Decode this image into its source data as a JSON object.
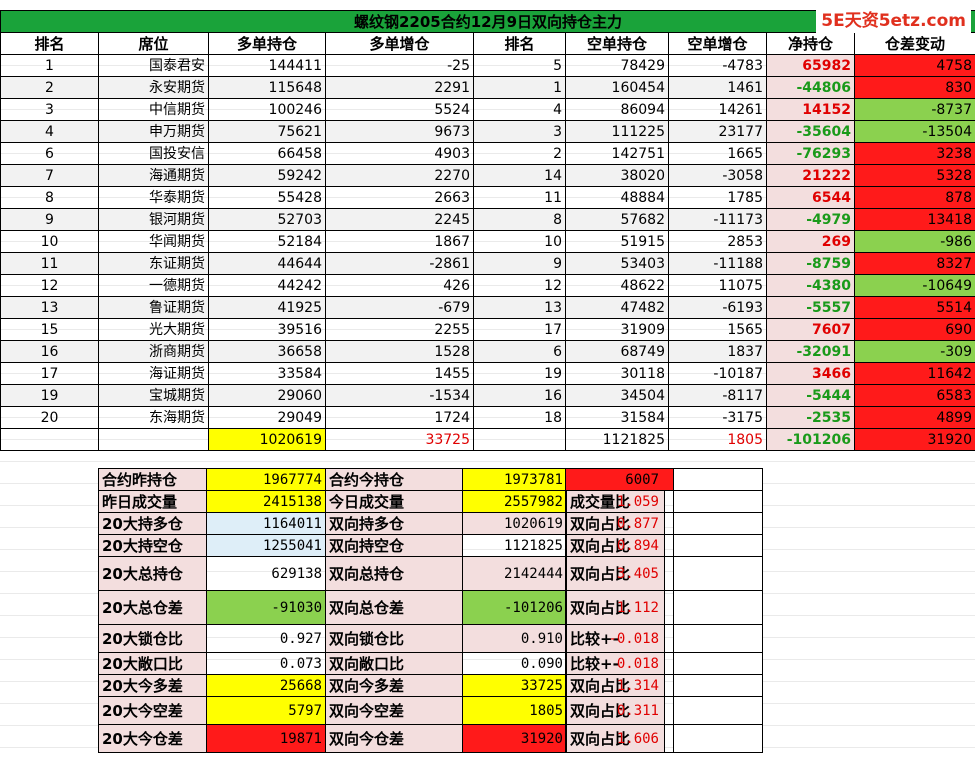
{
  "watermark": "5E天资5etz.com",
  "title": "螺纹钢2205合约12月9日双向持仓主力",
  "headers": [
    "排名",
    "席位",
    "多单持仓",
    "多单增仓",
    "排名",
    "空单持仓",
    "空单增仓",
    "净持仓",
    "仓差变动"
  ],
  "rows": [
    {
      "rank": "1",
      "firm": "国泰君安",
      "long": "144411",
      "long_chg": "-25",
      "srank": "5",
      "short": "78429",
      "short_chg": "-4783",
      "net": "65982",
      "diff": "4758"
    },
    {
      "rank": "2",
      "firm": "永安期货",
      "long": "115648",
      "long_chg": "2291",
      "srank": "1",
      "short": "160454",
      "short_chg": "1461",
      "net": "-44806",
      "diff": "830"
    },
    {
      "rank": "3",
      "firm": "中信期货",
      "long": "100246",
      "long_chg": "5524",
      "srank": "4",
      "short": "86094",
      "short_chg": "14261",
      "net": "14152",
      "diff": "-8737"
    },
    {
      "rank": "4",
      "firm": "申万期货",
      "long": "75621",
      "long_chg": "9673",
      "srank": "3",
      "short": "111225",
      "short_chg": "23177",
      "net": "-35604",
      "diff": "-13504"
    },
    {
      "rank": "6",
      "firm": "国投安信",
      "long": "66458",
      "long_chg": "4903",
      "srank": "2",
      "short": "142751",
      "short_chg": "1665",
      "net": "-76293",
      "diff": "3238"
    },
    {
      "rank": "7",
      "firm": "海通期货",
      "long": "59242",
      "long_chg": "2270",
      "srank": "14",
      "short": "38020",
      "short_chg": "-3058",
      "net": "21222",
      "diff": "5328"
    },
    {
      "rank": "8",
      "firm": "华泰期货",
      "long": "55428",
      "long_chg": "2663",
      "srank": "11",
      "short": "48884",
      "short_chg": "1785",
      "net": "6544",
      "diff": "878"
    },
    {
      "rank": "9",
      "firm": "银河期货",
      "long": "52703",
      "long_chg": "2245",
      "srank": "8",
      "short": "57682",
      "short_chg": "-11173",
      "net": "-4979",
      "diff": "13418"
    },
    {
      "rank": "10",
      "firm": "华闻期货",
      "long": "52184",
      "long_chg": "1867",
      "srank": "10",
      "short": "51915",
      "short_chg": "2853",
      "net": "269",
      "diff": "-986"
    },
    {
      "rank": "11",
      "firm": "东证期货",
      "long": "44644",
      "long_chg": "-2861",
      "srank": "9",
      "short": "53403",
      "short_chg": "-11188",
      "net": "-8759",
      "diff": "8327"
    },
    {
      "rank": "12",
      "firm": "一德期货",
      "long": "44242",
      "long_chg": "426",
      "srank": "12",
      "short": "48622",
      "short_chg": "11075",
      "net": "-4380",
      "diff": "-10649"
    },
    {
      "rank": "13",
      "firm": "鲁证期货",
      "long": "41925",
      "long_chg": "-679",
      "srank": "13",
      "short": "47482",
      "short_chg": "-6193",
      "net": "-5557",
      "diff": "5514"
    },
    {
      "rank": "15",
      "firm": "光大期货",
      "long": "39516",
      "long_chg": "2255",
      "srank": "17",
      "short": "31909",
      "short_chg": "1565",
      "net": "7607",
      "diff": "690"
    },
    {
      "rank": "16",
      "firm": "浙商期货",
      "long": "36658",
      "long_chg": "1528",
      "srank": "6",
      "short": "68749",
      "short_chg": "1837",
      "net": "-32091",
      "diff": "-309"
    },
    {
      "rank": "17",
      "firm": "海证期货",
      "long": "33584",
      "long_chg": "1455",
      "srank": "19",
      "short": "30118",
      "short_chg": "-10187",
      "net": "3466",
      "diff": "11642"
    },
    {
      "rank": "19",
      "firm": "宝城期货",
      "long": "29060",
      "long_chg": "-1534",
      "srank": "16",
      "short": "34504",
      "short_chg": "-8117",
      "net": "-5444",
      "diff": "6583"
    },
    {
      "rank": "20",
      "firm": "东海期货",
      "long": "29049",
      "long_chg": "1724",
      "srank": "18",
      "short": "31584",
      "short_chg": "-3175",
      "net": "-2535",
      "diff": "4899"
    }
  ],
  "totals": {
    "long": "1020619",
    "long_chg": "33725",
    "short": "1121825",
    "short_chg": "1805",
    "net": "-101206",
    "diff": "31920"
  },
  "summary": [
    {
      "l1": "合约昨持仓",
      "v1": "1967774",
      "l2": "合约今持仓",
      "v2": "1973781",
      "l3": "合约今仓差",
      "v3": "6007"
    },
    {
      "l1": "昨日成交量",
      "v1": "2415138",
      "l2": "今日成交量",
      "v2": "2557982",
      "l3": "成交量比",
      "v3": "1.059"
    },
    {
      "l1": "20大持多仓",
      "v1": "1164011",
      "l2": "双向持多仓",
      "v2": "1020619",
      "l3": "双向占比",
      "v3": "0.877"
    },
    {
      "l1": "20大持空仓",
      "v1": "1255041",
      "l2": "双向持空仓",
      "v2": "1121825",
      "l3": "双向占比",
      "v3": "0.894"
    },
    {
      "l1": "20大总持仓",
      "v1": "629138",
      "l2": "双向总持仓",
      "v2": "2142444",
      "l3": "双向占比",
      "v3": "3.405"
    },
    {
      "l1": "20大总仓差",
      "v1": "-91030",
      "l2": "双向总仓差",
      "v2": "-101206",
      "l3": "双向占比",
      "v3": "1.112"
    },
    {
      "l1": "20大锁仓比",
      "v1": "0.927",
      "l2": "双向锁仓比",
      "v2": "0.910",
      "l3": "比较+-",
      "v3": "-0.018"
    },
    {
      "l1": "20大敞口比",
      "v1": "0.073",
      "l2": "双向敞口比",
      "v2": "0.090",
      "l3": "比较+-",
      "v3": "0.018"
    },
    {
      "l1": "20大今多差",
      "v1": "25668",
      "l2": "双向今多差",
      "v2": "33725",
      "l3": "双向占比",
      "v3": "1.314"
    },
    {
      "l1": "20大今空差",
      "v1": "5797",
      "l2": "双向今空差",
      "v2": "1805",
      "l3": "双向占比",
      "v3": "0.311"
    },
    {
      "l1": "20大今仓差",
      "v1": "19871",
      "l2": "双向今仓差",
      "v2": "31920",
      "l3": "双向占比",
      "v3": "1.606"
    }
  ],
  "colors": {
    "title_bg": "#1aa33a",
    "positive": "#e00000",
    "negative": "#1a9a1a",
    "cell_red": "#ff1a1a",
    "cell_green": "#8bd14f",
    "highlight": "#ffff00",
    "pink": "#f3dede"
  }
}
